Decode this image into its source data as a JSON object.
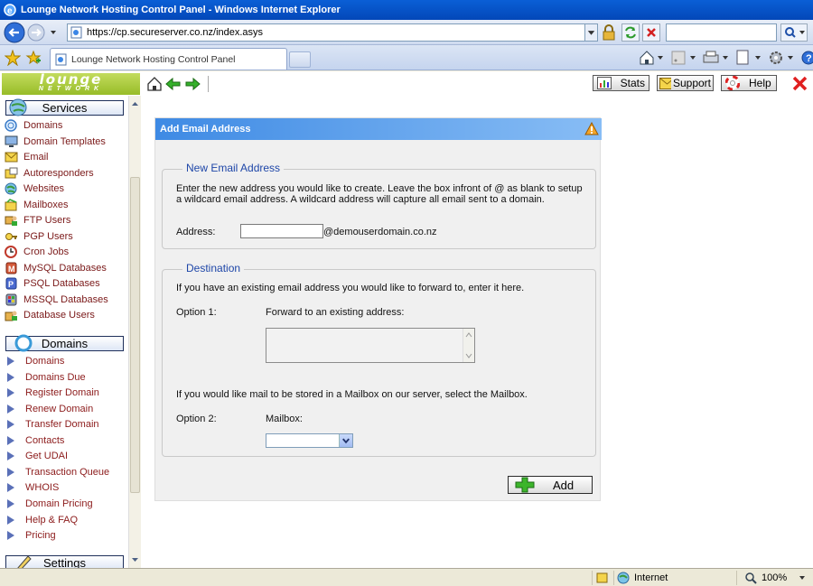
{
  "window": {
    "title": "Lounge Network Hosting Control Panel - Windows Internet Explorer"
  },
  "browser": {
    "url": "https://cp.secureserver.co.nz/index.asys",
    "tab_title": "Lounge Network Hosting Control Panel",
    "search_value": ""
  },
  "logo": {
    "line1": "lounge",
    "line2": "NETWORK"
  },
  "topbar": {
    "stats": "Stats",
    "support": "Support",
    "help": "Help"
  },
  "sidebar": {
    "services_header": "Services",
    "services": [
      "Domains",
      "Domain Templates",
      "Email",
      "Autoresponders",
      "Websites",
      "Mailboxes",
      "FTP Users",
      "PGP Users",
      "Cron Jobs",
      "MySQL Databases",
      "PSQL Databases",
      "MSSQL Databases",
      "Database Users"
    ],
    "domains_header": "Domains",
    "domains": [
      "Domains",
      "Domains Due",
      "Register Domain",
      "Renew Domain",
      "Transfer Domain",
      "Contacts",
      "Get UDAI",
      "Transaction Queue",
      "WHOIS",
      "Domain Pricing",
      "Help & FAQ",
      "Pricing"
    ],
    "settings_header": "Settings"
  },
  "panel": {
    "title": "Add Email Address",
    "new_email": {
      "legend": "New Email Address",
      "description": "Enter the new address you would like to create. Leave the box infront of @ as blank to setup a wildcard email address. A wildcard address will capture all email sent to a domain.",
      "address_label": "Address:",
      "address_value": "",
      "domain_suffix": "@demouserdomain.co.nz"
    },
    "destination": {
      "legend": "Destination",
      "forward_intro": "If you have an existing email address you would like to forward to, enter it here.",
      "option1_label": "Option 1:",
      "forward_label": "Forward to an existing address:",
      "forward_value": "",
      "mailbox_intro": "If you would like mail to be stored in a Mailbox on our server, select the Mailbox.",
      "option2_label": "Option 2:",
      "mailbox_label": "Mailbox:",
      "mailbox_selected": ""
    },
    "add_label": "Add"
  },
  "status": {
    "zone": "Internet",
    "zoom": "100%"
  }
}
